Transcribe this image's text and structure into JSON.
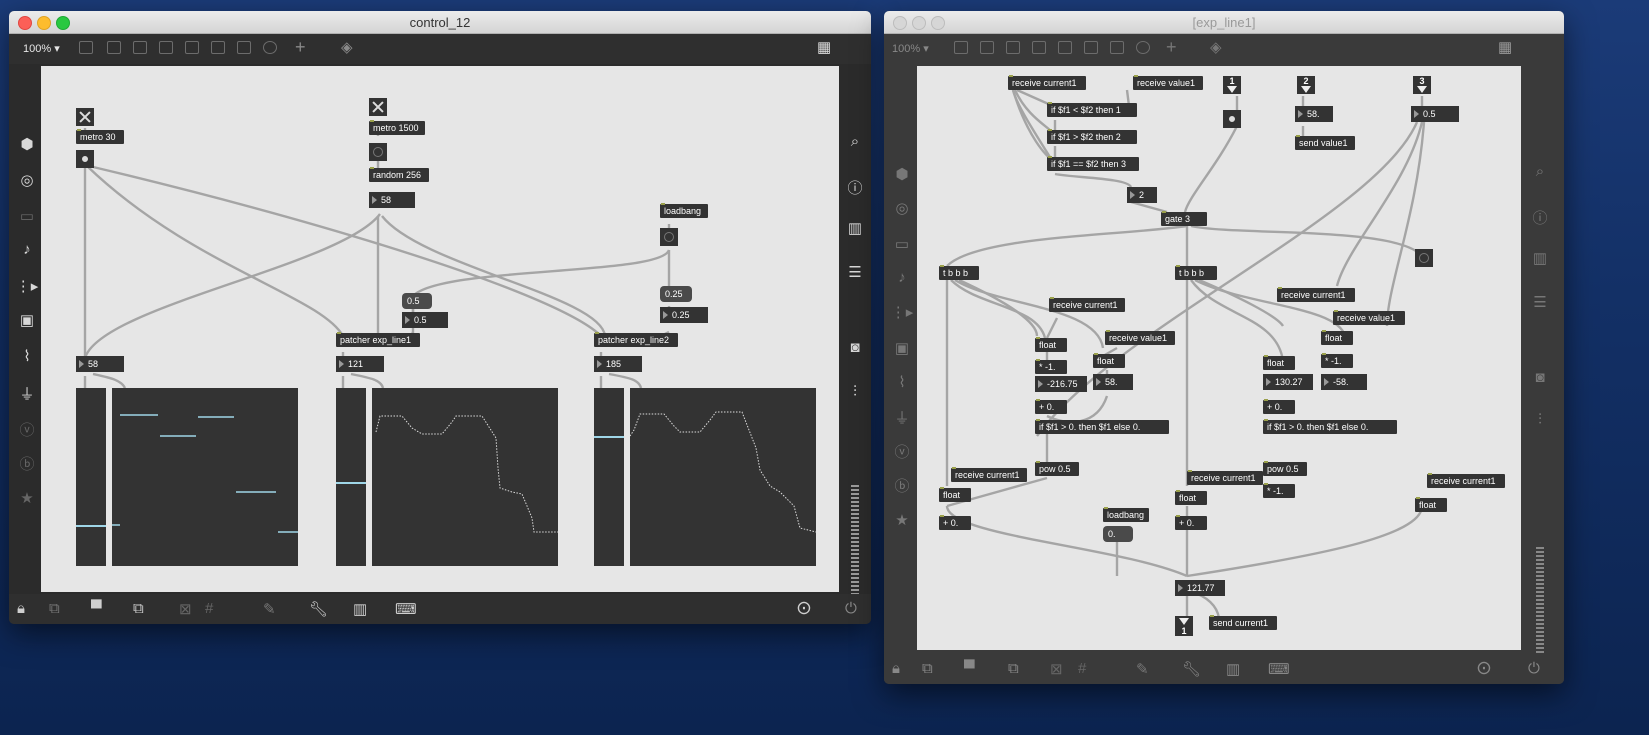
{
  "window1": {
    "title": "control_12",
    "zoom": "100%",
    "objects": {
      "metro30": "metro 30",
      "metro1500": "metro 1500",
      "random": "random 256",
      "random_out": "58",
      "loadbang": "loadbang",
      "msg_05": "0.5",
      "num_05": "0.5",
      "msg_025": "0.25",
      "num_025": "0.25",
      "patcher1": "patcher exp_line1",
      "patcher2": "patcher exp_line2",
      "num_58": "58",
      "num_121": "121",
      "num_185": "185"
    },
    "sliders": {
      "slider1": 0.23,
      "slider2": 0.47,
      "slider3": 0.73
    }
  },
  "window2": {
    "title": "[exp_line1]",
    "zoom": "100%",
    "objects": {
      "receive_current_top": "receive current1",
      "receive_value_top": "receive value1",
      "if_lt": "if $f1 < $f2 then 1",
      "if_gt": "if $f1 > $f2 then 2",
      "if_eq": "if $f1 == $f2 then 3",
      "num_2": "2",
      "gate": "gate 3",
      "inlet1": "1",
      "inlet2": "2",
      "inlet3": "3",
      "num_58b": "58.",
      "send_value": "send value1",
      "num_half": "0.5",
      "tbbb_left": "t b b b",
      "tbbb_mid": "t b b b",
      "recv_cur_a": "receive current1",
      "float_a": "float",
      "mul_a": "* -1.",
      "num_a": "-216.75",
      "plus_a": "+ 0.",
      "if_a": "if $f1 > 0. then $f1 else 0.",
      "pow_a": "pow 0.5",
      "recv_val_a": "receive value1",
      "float_b": "float",
      "num_b": "58.",
      "recv_cur_b": "receive current1",
      "float_c": "float",
      "plus_c": "+ 0.",
      "loadbang": "loadbang",
      "msg_0": "0.",
      "recv_cur_d": "receive current1",
      "float_d": "float",
      "plus_d": "+ 0.",
      "recv_cur_e": "receive current1",
      "float_e": "float",
      "num_e": "130.27",
      "plus_e": "+ 0.",
      "if_e": "if $f1 > 0. then $f1 else 0.",
      "pow_e": "pow 0.5",
      "mul_e2": "* -1.",
      "recv_val_f": "receive value1",
      "float_f": "float",
      "mul_f": "* -1.",
      "num_f": "-58.",
      "recv_cur_g": "receive current1",
      "float_g": "float",
      "num_out": "121.77",
      "outlet": "1",
      "send_current": "send current1"
    }
  }
}
